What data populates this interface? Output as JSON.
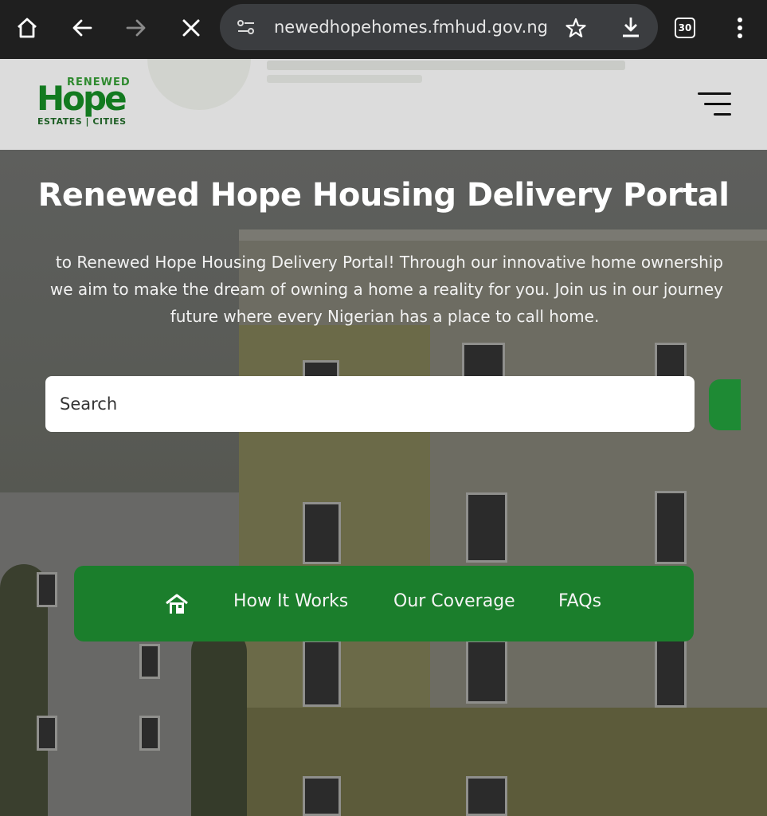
{
  "browser": {
    "url": "newedhopehomes.fmhud.gov.ng",
    "tab_count": "30"
  },
  "header": {
    "logo": {
      "top": "RENEWED",
      "main": "Hope",
      "bottom": "ESTATES | CITIES"
    }
  },
  "hero": {
    "title": "Renewed Hope Housing Delivery Portal",
    "lines": [
      "to Renewed Hope Housing Delivery Portal! Through our innovative home ownership",
      "we aim to make the dream of owning a home a reality for you. Join us in our journey",
      "future where every Nigerian has a place to call home."
    ],
    "search_placeholder": "Search"
  },
  "nav": {
    "items": [
      "How It Works",
      "Our Coverage",
      "FAQs"
    ]
  },
  "colors": {
    "brand_green": "#1b7e2c",
    "chrome_bg": "#1f1f1f"
  },
  "icons": [
    "home-icon",
    "back-icon",
    "forward-icon",
    "close-icon",
    "site-settings-icon",
    "star-icon",
    "download-icon",
    "more-icon",
    "menu-icon",
    "house-icon"
  ]
}
